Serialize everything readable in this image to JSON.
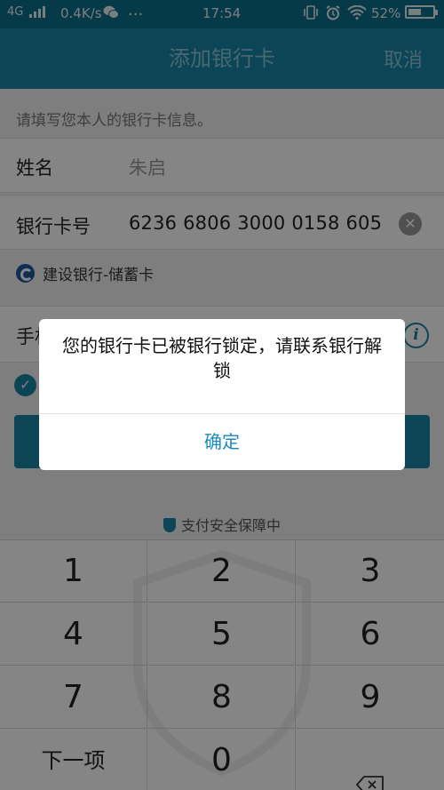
{
  "status_bar": {
    "network": "4G",
    "speed": "0.4K/s",
    "dots": "···",
    "time": "17:54",
    "battery": "52%",
    "battery_level": 0.52
  },
  "header": {
    "title": "添加银行卡",
    "cancel": "取消"
  },
  "form": {
    "hint": "请填写您本人的银行卡信息。",
    "name_label": "姓名",
    "name_value": "朱启",
    "card_label": "银行卡号",
    "card_value": "6236 6806 3000 0158 605",
    "bank_name": "建设银行-储蓄卡",
    "phone_label": "手机号"
  },
  "secure": {
    "text": "支付安全保障中"
  },
  "keypad": {
    "keys": [
      "1",
      "2",
      "3",
      "4",
      "5",
      "6",
      "7",
      "8",
      "9",
      "下一项",
      "0"
    ],
    "delete_icon": "backspace-icon"
  },
  "dialog": {
    "message": "您的银行卡已被银行锁定，请联系银行解锁",
    "ok": "确定"
  },
  "colors": {
    "accent": "#1784a6",
    "status_bar": "#0e6f8d",
    "dialog_button": "#1b8ac0"
  }
}
